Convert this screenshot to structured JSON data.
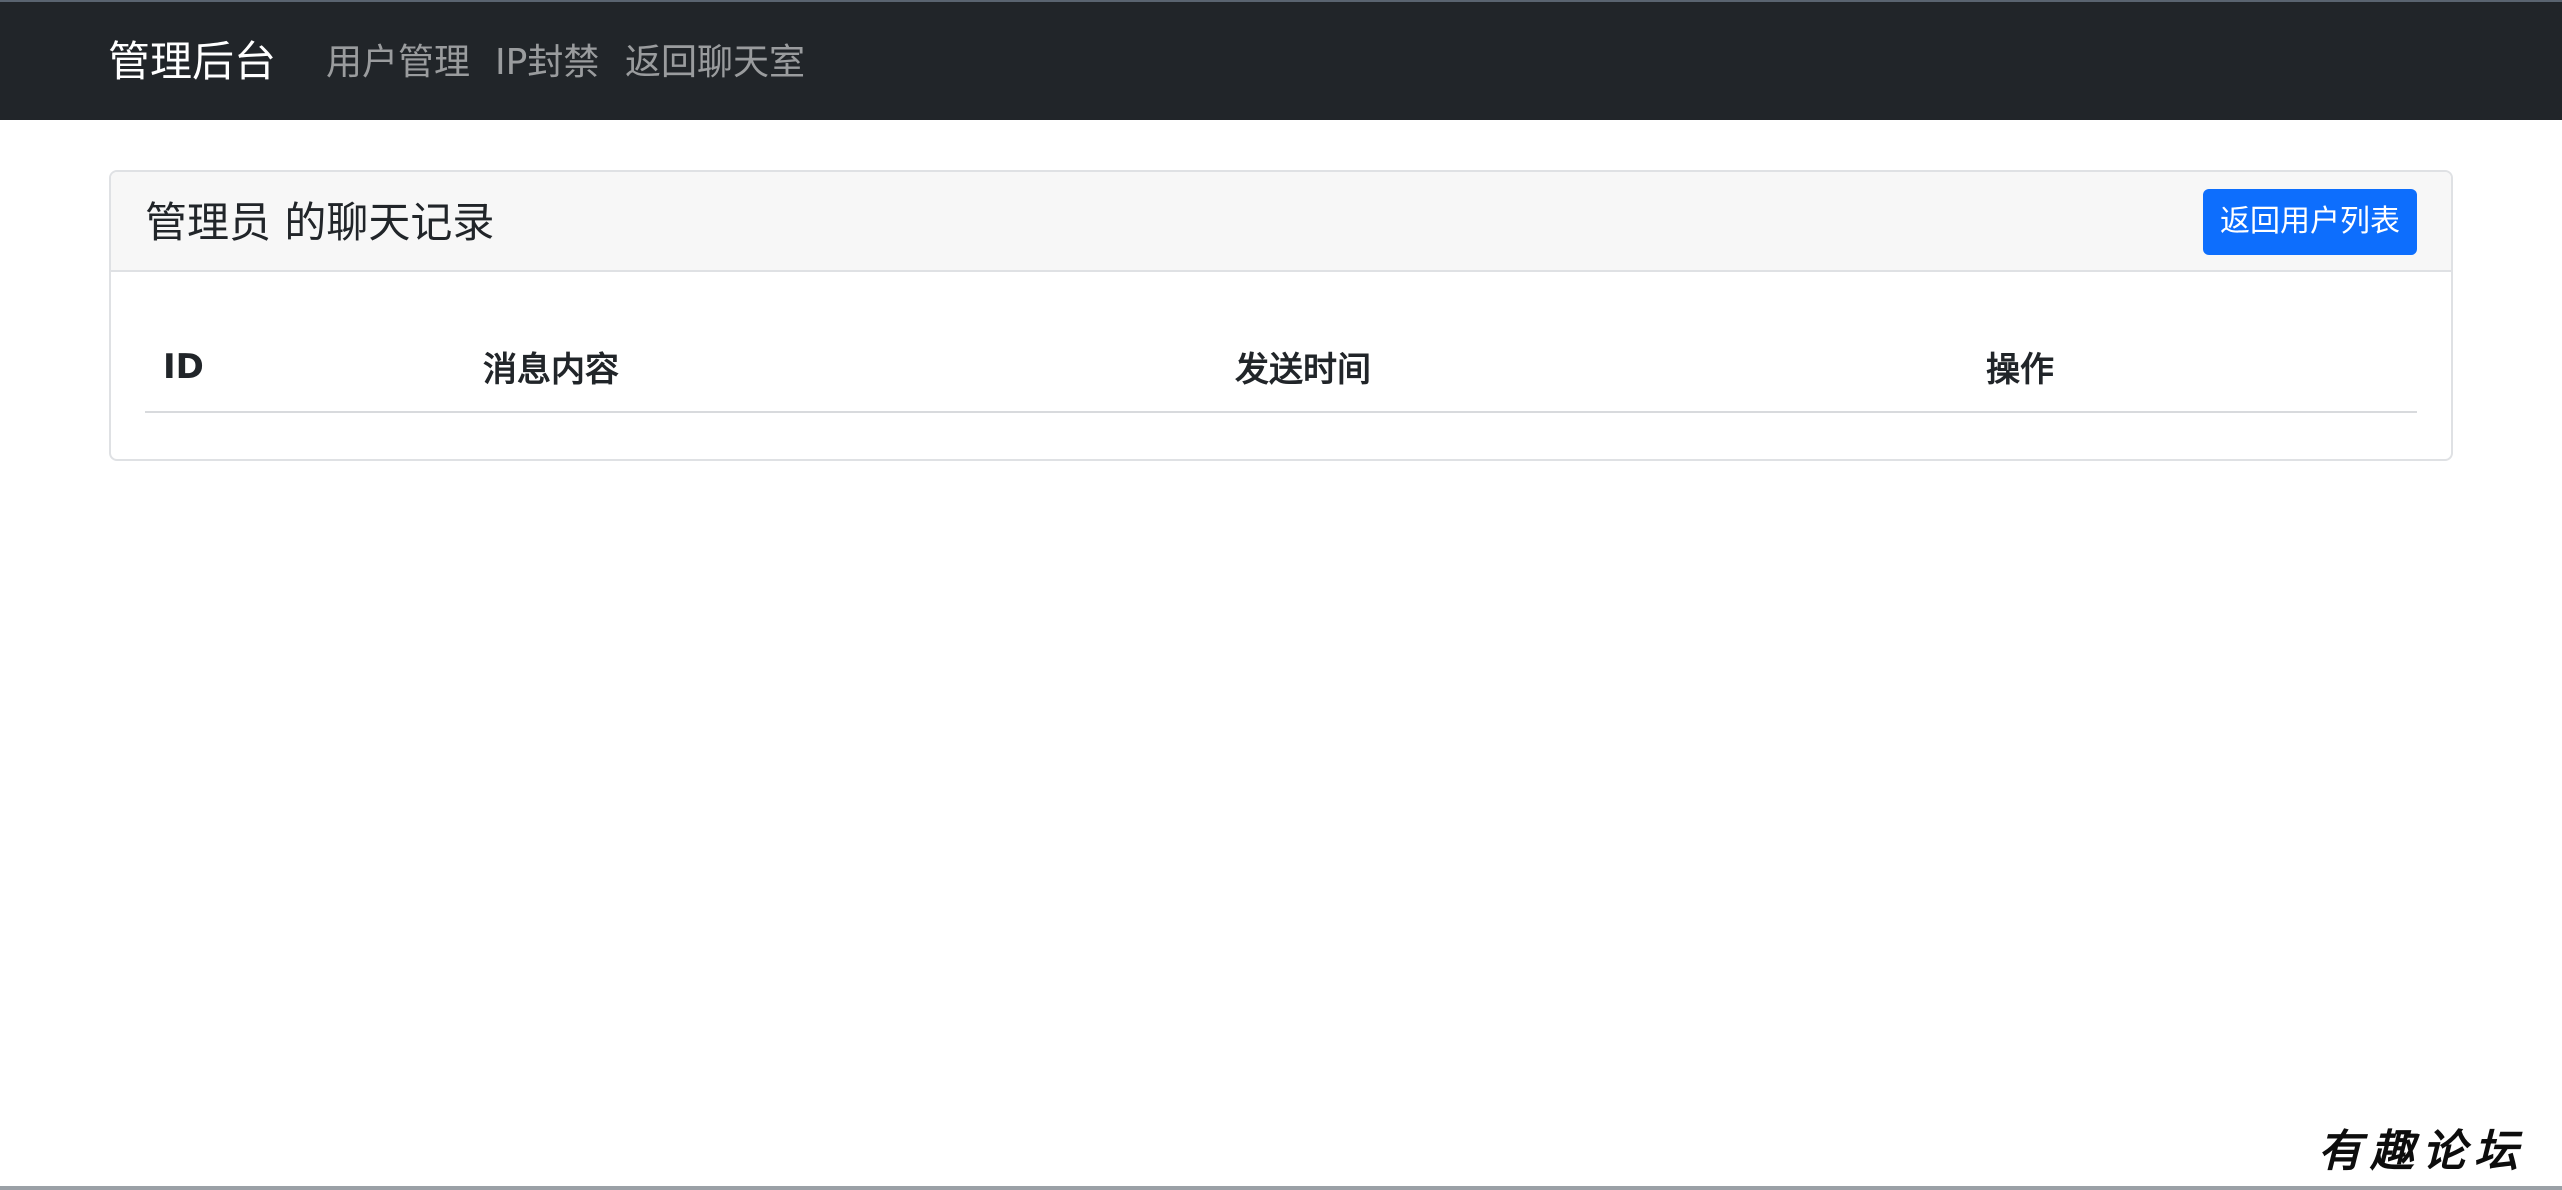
{
  "navbar": {
    "brand": "管理后台",
    "links": [
      {
        "label": "用户管理"
      },
      {
        "label": "IP封禁"
      },
      {
        "label": "返回聊天室"
      }
    ]
  },
  "card": {
    "title": "管理员 的聊天记录",
    "back_button_label": "返回用户列表"
  },
  "table": {
    "columns": [
      "ID",
      "消息内容",
      "发送时间",
      "操作"
    ],
    "rows": []
  },
  "watermark": "有趣论坛"
}
